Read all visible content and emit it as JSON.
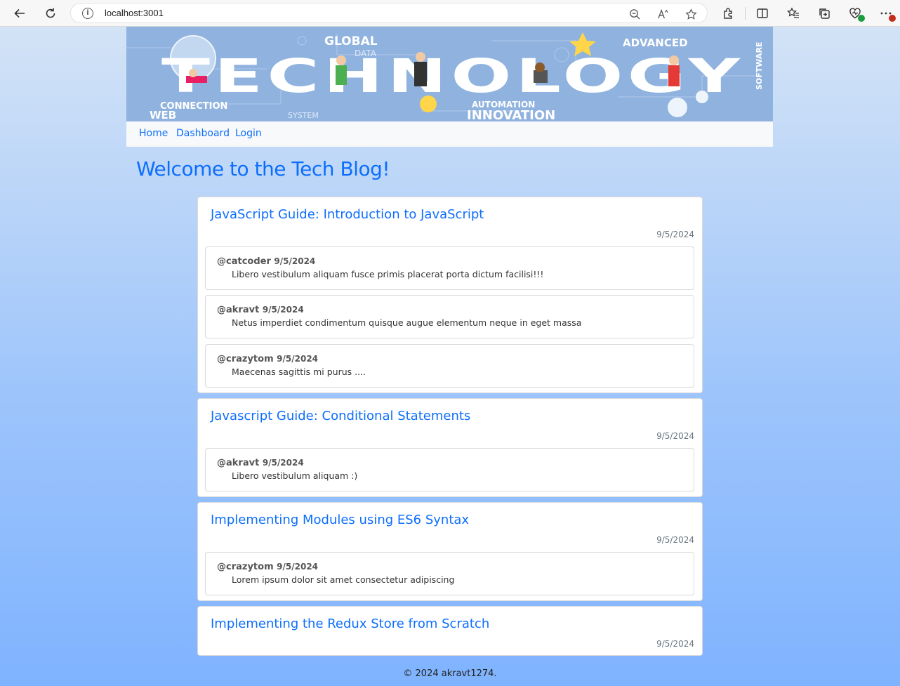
{
  "browser": {
    "url": "localhost:3001"
  },
  "header": {
    "banner_words": [
      "GLOBAL",
      "DATA",
      "ADVANCED",
      "TECHNOLOGY",
      "SOFTWARE",
      "CONNECTION",
      "WEB",
      "SYSTEM",
      "AUTOMATION",
      "INNOVATION"
    ]
  },
  "nav": {
    "home": "Home",
    "dashboard": "Dashboard",
    "login": "Login"
  },
  "main": {
    "heading": "Welcome to the Tech Blog!",
    "posts": [
      {
        "title": "JavaScript Guide: Introduction to JavaScript",
        "date": "9/5/2024",
        "comments": [
          {
            "user": "@catcoder",
            "date": "9/5/2024",
            "text": "Libero vestibulum aliquam fusce primis placerat porta dictum facilisi!!!"
          },
          {
            "user": "@akravt",
            "date": "9/5/2024",
            "text": "Netus imperdiet condimentum quisque augue elementum neque in eget massa"
          },
          {
            "user": "@crazytom",
            "date": "9/5/2024",
            "text": "Maecenas sagittis mi purus ...."
          }
        ]
      },
      {
        "title": "Javascript Guide: Conditional Statements",
        "date": "9/5/2024",
        "comments": [
          {
            "user": "@akravt",
            "date": "9/5/2024",
            "text": "Libero vestibulum aliquam :)"
          }
        ]
      },
      {
        "title": "Implementing Modules using ES6 Syntax",
        "date": "9/5/2024",
        "comments": [
          {
            "user": "@crazytom",
            "date": "9/5/2024",
            "text": "Lorem ipsum dolor sit amet consectetur adipiscing"
          }
        ]
      },
      {
        "title": "Implementing the Redux Store from Scratch",
        "date": "9/5/2024",
        "comments": []
      }
    ]
  },
  "footer": {
    "text": "© 2024 akravt1274."
  },
  "colors": {
    "link": "#0d6efd",
    "bg_top": "#d3e3f6",
    "bg_bottom": "#7fb3ff"
  }
}
